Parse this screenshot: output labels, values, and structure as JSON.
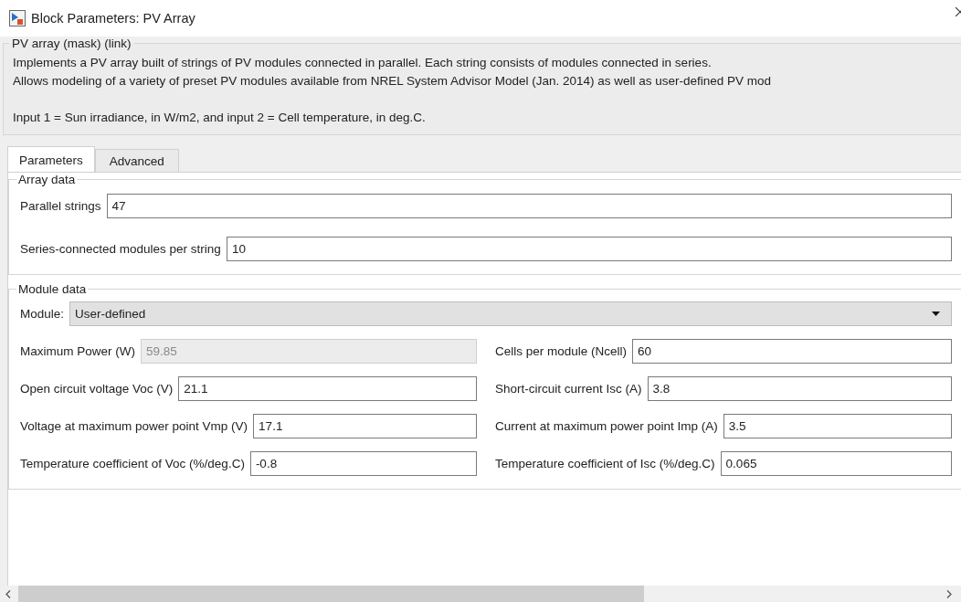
{
  "window": {
    "title": "Block Parameters: PV Array"
  },
  "mask": {
    "title": "PV array (mask) (link)",
    "lines": [
      "Implements a PV array built of strings of PV modules connected in parallel. Each string consists of modules connected in series.",
      "Allows modeling of a variety of preset PV modules available from NREL System Advisor Model (Jan. 2014) as well as user-defined PV mod",
      "Input 1 = Sun irradiance, in W/m2, and input 2 = Cell temperature, in deg.C."
    ]
  },
  "tabs": [
    {
      "label": "Parameters",
      "selected": true
    },
    {
      "label": "Advanced",
      "selected": false
    }
  ],
  "array_data": {
    "title": "Array data",
    "fields": [
      {
        "label": "Parallel strings",
        "value": "47"
      },
      {
        "label": "Series-connected modules per string",
        "value": "10"
      }
    ]
  },
  "module_data": {
    "title": "Module data",
    "module": {
      "label": "Module:",
      "value": "User-defined"
    },
    "fields": [
      {
        "label": "Maximum Power (W)",
        "value": "59.85",
        "disabled": true
      },
      {
        "label": "Cells per module (Ncell)",
        "value": "60",
        "disabled": false
      },
      {
        "label": "Open circuit voltage  Voc (V)",
        "value": "21.1",
        "disabled": false
      },
      {
        "label": "Short-circuit current Isc (A)",
        "value": "3.8",
        "disabled": false
      },
      {
        "label": "Voltage at maximum power point Vmp (V)",
        "value": "17.1",
        "disabled": false
      },
      {
        "label": "Current at maximum power point Imp (A)",
        "value": "3.5",
        "disabled": false
      },
      {
        "label": "Temperature coefficient of Voc (%/deg.C)",
        "value": "-0.8",
        "disabled": false
      },
      {
        "label": "Temperature coefficient of Isc (%/deg.C)",
        "value": "0.065",
        "disabled": false
      }
    ]
  }
}
